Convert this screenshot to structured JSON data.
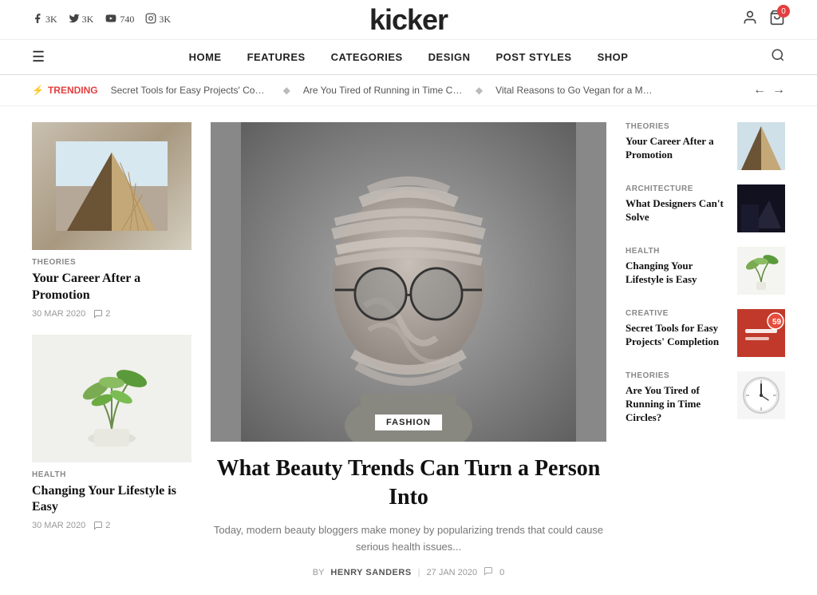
{
  "site": {
    "name": "kicker"
  },
  "social": [
    {
      "icon": "f",
      "label": "3K"
    },
    {
      "icon": "t",
      "label": "3K"
    },
    {
      "icon": "yt",
      "label": "740"
    },
    {
      "icon": "ig",
      "label": "3K"
    }
  ],
  "topRight": {
    "user_icon": "person",
    "cart_icon": "cart",
    "cart_count": "0"
  },
  "nav": {
    "menu_icon": "☰",
    "links": [
      "HOME",
      "FEATURES",
      "CATEGORIES",
      "DESIGN",
      "POST STYLES",
      "SHOP"
    ],
    "search_icon": "search"
  },
  "trending": {
    "label": "TRENDING",
    "items": [
      "Secret Tools for Easy Projects' Compl ...",
      "Are You Tired of Running in Time Circl...",
      "Vital Reasons to Go Vegan for a Month"
    ]
  },
  "left_cards": [
    {
      "category": "THEORIES",
      "title": "Your Career After a Promotion",
      "date": "30 MAR 2020",
      "comments": "2",
      "img_type": "building"
    },
    {
      "category": "HEALTH",
      "title": "Changing Your Lifestyle is Easy",
      "date": "30 MAR 2020",
      "comments": "2",
      "img_type": "plant"
    }
  ],
  "hero": {
    "category": "FASHION",
    "title": "What Beauty Trends Can Turn a Person Into",
    "description": "Today, modern beauty bloggers make money by popularizing trends that could cause serious health issues...",
    "by": "BY",
    "author": "HENRY SANDERS",
    "date": "27 JAN 2020",
    "comments": "0"
  },
  "sidebar_items": [
    {
      "category": "THEORIES",
      "title": "Your Career After a Promotion",
      "img_type": "building"
    },
    {
      "category": "ARCHITECTURE",
      "title": "What Designers Can't Solve",
      "img_type": "dark"
    },
    {
      "category": "HEALTH",
      "title": "Changing Your Lifestyle is Easy",
      "img_type": "plant2"
    },
    {
      "category": "CREATIVE",
      "title": "Secret Tools for Easy Projects' Completion",
      "img_type": "red"
    },
    {
      "category": "THEORIES",
      "title": "Are You Tired of Running in Time Circles?",
      "img_type": "clock"
    }
  ]
}
